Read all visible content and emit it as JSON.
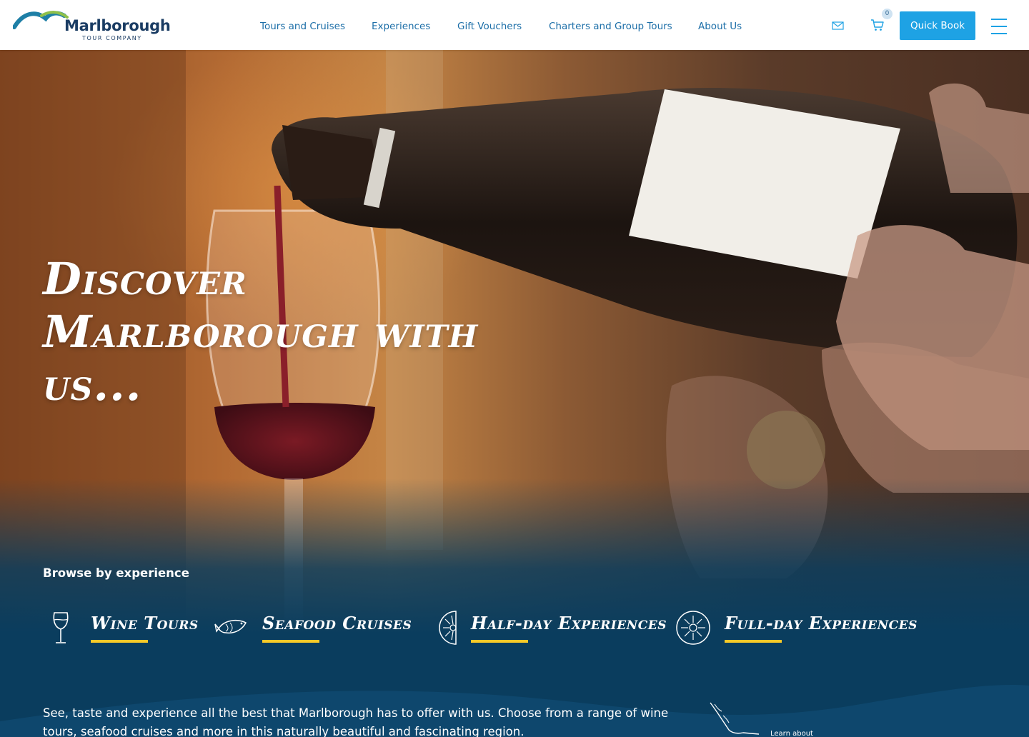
{
  "brand": {
    "name": "Marlborough",
    "tagline": "TOUR COMPANY",
    "colors": {
      "navy": "#1a3c63",
      "teal": "#1e7fa6",
      "green": "#8fc04a",
      "accent": "#1ea2e4",
      "yellow": "#f7c928",
      "deep_blue": "#0a3d5e"
    }
  },
  "nav": {
    "items": [
      {
        "label": "Tours and Cruises"
      },
      {
        "label": "Experiences"
      },
      {
        "label": "Gift Vouchers"
      },
      {
        "label": "Charters and Group Tours"
      },
      {
        "label": "About Us"
      }
    ]
  },
  "header_actions": {
    "mail_icon": "mail-icon",
    "cart_icon": "cart-icon",
    "cart_count": "0",
    "quick_book_label": "Quick Book",
    "menu_icon": "hamburger-menu-icon"
  },
  "hero": {
    "title_line1": "Discover",
    "title_line2": "Marlborough with",
    "title_line3": "us...",
    "browse_label": "Browse by experience",
    "experiences": [
      {
        "label": "Wine Tours",
        "icon": "wine-glass-icon"
      },
      {
        "label": "Seafood Cruises",
        "icon": "fish-icon"
      },
      {
        "label": "Half-day Experiences",
        "icon": "half-sun-icon"
      },
      {
        "label": "Full-day Experiences",
        "icon": "full-sun-icon"
      }
    ],
    "intro_text": "See, taste and experience all the best that Marlborough has to offer with us. Choose from a range of wine tours, seafood cruises and more in this naturally beautiful and fascinating region.",
    "learn_about_label": "Learn about"
  }
}
